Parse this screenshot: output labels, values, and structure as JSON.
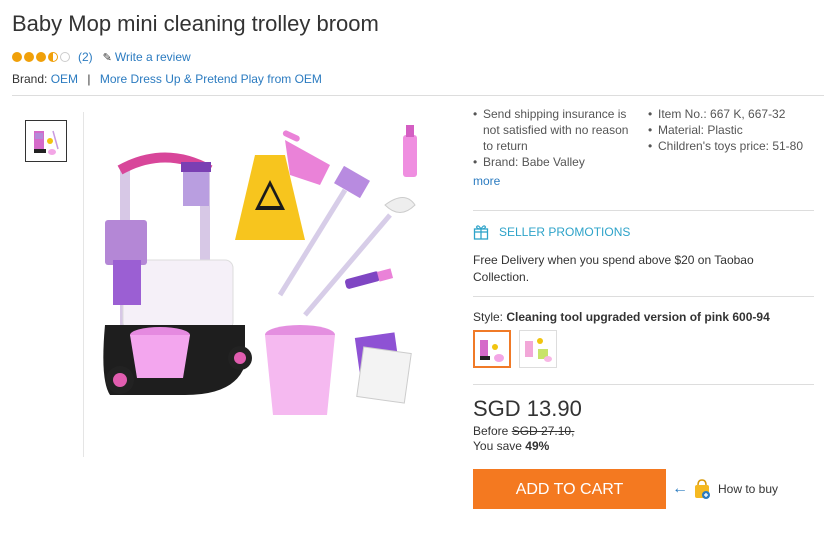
{
  "product": {
    "title": "Baby Mop mini cleaning trolley broom",
    "rating": 3.5,
    "review_count": "(2)",
    "write_review": "Write a review"
  },
  "brand": {
    "label": "Brand:",
    "value": "OEM",
    "separator": "|",
    "more_link": "More Dress Up & Pretend Play from OEM"
  },
  "specs": {
    "left": [
      "Send shipping insurance is not satisfied with no reason to return",
      "Brand: Babe Valley"
    ],
    "right": [
      "Item No.: 667 K, 667-32",
      "Material: Plastic",
      "Children's toys price: 51-80"
    ],
    "more": "more"
  },
  "promotions": {
    "title": "SELLER PROMOTIONS",
    "text": "Free Delivery when you spend above $20 on Taobao Collection."
  },
  "style": {
    "label": "Style:",
    "selected": "Cleaning tool upgraded version of pink 600-94"
  },
  "pricing": {
    "price": "SGD 13.90",
    "before_label": "Before",
    "before_value": "SGD 27.10,",
    "save_label": "You save",
    "save_value": "49%"
  },
  "actions": {
    "add_to_cart": "ADD TO CART",
    "how_to_buy": "How to buy"
  },
  "icons": {
    "stars": "star-icon",
    "pencil": "pencil-icon",
    "gift": "gift-icon",
    "arrow": "arrow-left-icon",
    "bag": "shopping-bag-icon"
  },
  "colors": {
    "accent": "#f47920",
    "link": "#2b7bc0",
    "promo": "#2ea3c9",
    "star": "#f0a00a"
  }
}
